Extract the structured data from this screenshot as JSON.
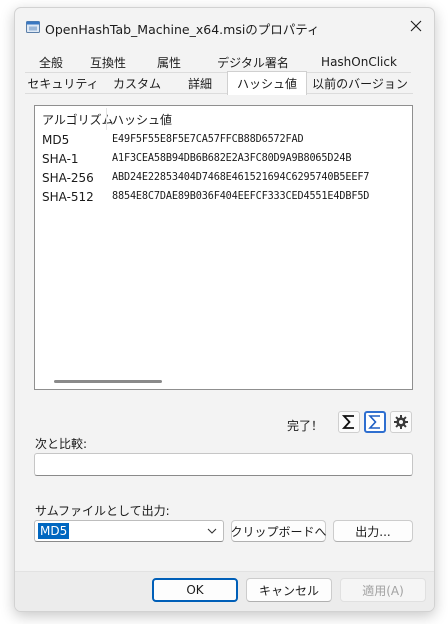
{
  "window": {
    "title": "OpenHashTab_Machine_x64.msiのプロパティ",
    "close_glyph": "✕"
  },
  "tabs": {
    "row1": [
      "全般",
      "互換性",
      "属性",
      "デジタル署名",
      "HashOnClick"
    ],
    "row2": [
      "セキュリティ",
      "カスタム",
      "詳細",
      "ハッシュ値",
      "以前のバージョン"
    ],
    "active": "ハッシュ値"
  },
  "hash_list": {
    "columns": [
      "アルゴリズム",
      "ハッシュ値"
    ],
    "rows": [
      {
        "algo": "MD5",
        "hash": "E49F5F55E8F5E7CA57FFCB88D6572FAD"
      },
      {
        "algo": "SHA-1",
        "hash": "A1F3CEA58B94DB6B682E2A3FC80D9A9B8065D24B"
      },
      {
        "algo": "SHA-256",
        "hash": "ABD24E22853404D7468E461521694C6295740B5EEF7"
      },
      {
        "algo": "SHA-512",
        "hash": "8854E8C7DAE89B036F404EEFCF333CED4551E4DBF5D"
      }
    ]
  },
  "status": {
    "text": "完了！",
    "icons": [
      "sigma-icon",
      "export-sum-icon",
      "gear-icon"
    ]
  },
  "compare": {
    "label": "次と比較:",
    "value": ""
  },
  "output": {
    "label": "サムファイルとして出力:",
    "selected": "MD5",
    "clipboard_button": "クリップボードへ",
    "output_button": "出力..."
  },
  "footer": {
    "ok": "OK",
    "cancel": "キャンセル",
    "apply": "適用(A)"
  },
  "colors": {
    "accent": "#0067c0",
    "window_bg": "#f3f3f3"
  }
}
